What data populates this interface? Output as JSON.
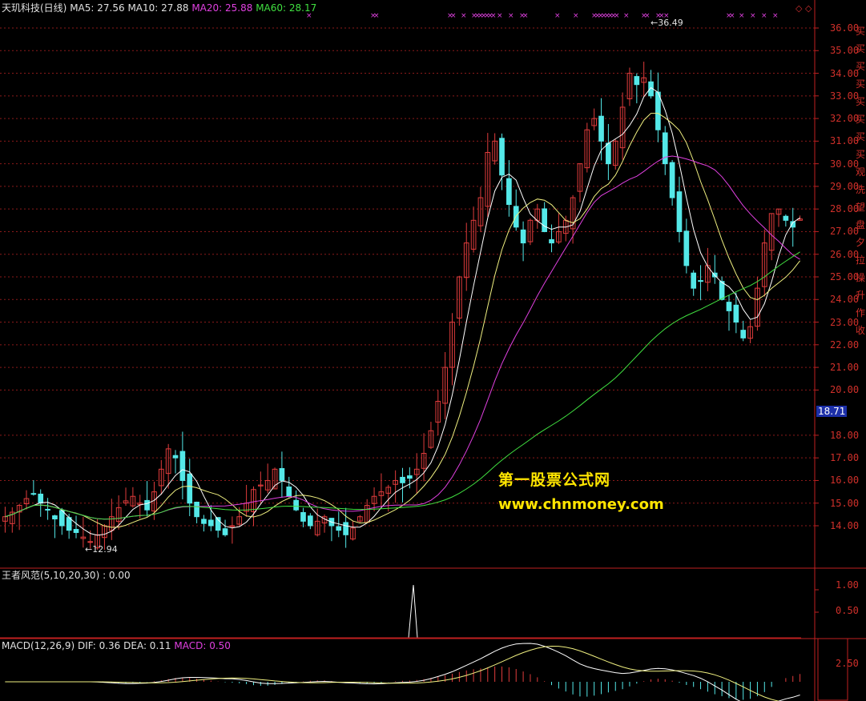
{
  "header": {
    "stock": "天玑科技(日线)",
    "ma5": "MA5: 27.56",
    "ma10": "MA10: 27.88",
    "ma20": "MA20: 25.88",
    "ma60": "MA60: 28.17"
  },
  "indicator1": {
    "title": "王者风范(5,10,20,30) : 0.00",
    "ticks": [
      "1.00",
      "0.50"
    ]
  },
  "macd": {
    "title": "MACD(12,26,9)",
    "dif": "DIF: 0.36",
    "dea": "DEA: 0.11",
    "macd": "MACD: 0.50",
    "ticks": [
      "2.50"
    ]
  },
  "price_axis": {
    "ticks": [
      "36.00",
      "35.00",
      "34.00",
      "33.00",
      "32.00",
      "31.00",
      "30.00",
      "29.00",
      "28.00",
      "27.00",
      "26.00",
      "25.00",
      "24.00",
      "23.00",
      "22.00",
      "21.00",
      "20.00",
      "18.00",
      "17.00",
      "16.00",
      "15.00",
      "14.00"
    ],
    "current_price": "18.71"
  },
  "annotations": {
    "high": "36.49",
    "low": "12.94"
  },
  "watermark": {
    "line1": "第一股票公式网",
    "line2": "www.chnmoney.com"
  },
  "right_labels": [
    "买",
    "买",
    "买",
    "买",
    "买",
    "买",
    "买",
    "买",
    "观",
    "洗",
    "望",
    "盘",
    "夕",
    "拉",
    "操",
    "升",
    "作",
    "收"
  ],
  "colors": {
    "up": "#e03c3c",
    "down": "#54e8e8",
    "ma5": "#ffffff",
    "ma10": "#f0f080",
    "ma20": "#e040e0",
    "ma60": "#40e040",
    "grid": "#8b1a1a",
    "axis": "#c02020"
  },
  "chart_data": {
    "type": "candlestick",
    "title": "天玑科技(日线)",
    "y_range": [
      12.5,
      36.8
    ],
    "high": 36.49,
    "low": 12.94,
    "close_series": [
      14.4,
      14.6,
      14.9,
      15.2,
      15.4,
      15.0,
      14.7,
      14.3,
      14.0,
      13.8,
      13.7,
      13.5,
      13.3,
      13.6,
      14.0,
      14.4,
      14.8,
      15.1,
      15.3,
      15.0,
      14.7,
      15.5,
      16.5,
      17.4,
      17.0,
      16.0,
      15.0,
      14.4,
      14.1,
      14.0,
      13.8,
      13.6,
      14.0,
      14.4,
      15.0,
      15.6,
      15.8,
      16.0,
      16.5,
      16.0,
      15.3,
      14.7,
      14.2,
      14.0,
      14.2,
      14.4,
      14.0,
      13.8,
      13.6,
      13.9,
      14.4,
      14.9,
      15.3,
      15.5,
      15.7,
      16.0,
      15.9,
      16.1,
      16.5,
      17.2,
      18.2,
      19.5,
      21.0,
      23.0,
      25.0,
      26.5,
      27.5,
      28.5,
      30.5,
      31.0,
      29.5,
      28.2,
      27.2,
      26.5,
      27.5,
      28.0,
      27.0,
      26.5,
      27.0,
      27.5,
      28.5,
      30.0,
      31.5,
      32.0,
      31.0,
      30.0,
      31.0,
      32.5,
      34.0,
      33.5,
      33.8,
      33.0,
      31.5,
      30.0,
      28.5,
      27.0,
      25.5,
      24.5,
      24.8,
      25.5,
      25.0,
      24.0,
      23.5,
      23.0,
      22.3,
      22.8,
      24.5,
      26.5,
      27.8,
      28.0,
      27.5,
      27.2,
      27.56
    ]
  }
}
